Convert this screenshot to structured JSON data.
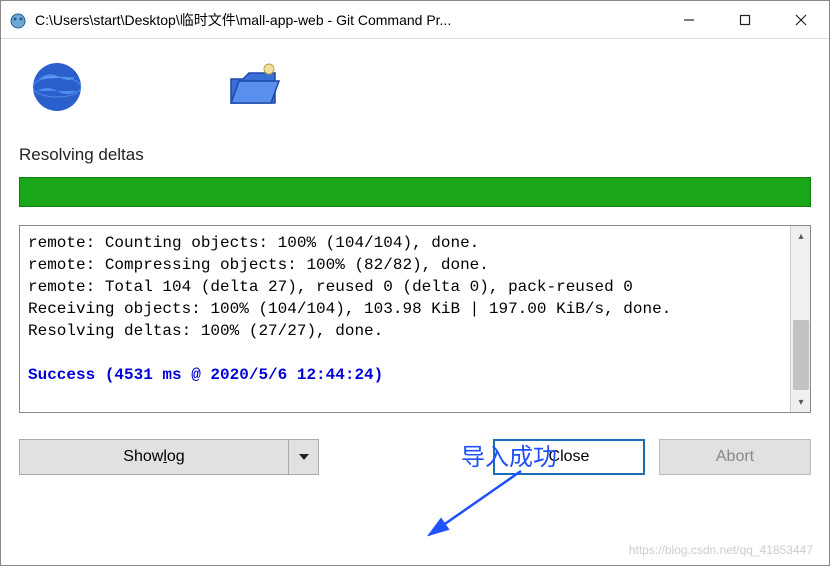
{
  "window": {
    "title": "C:\\Users\\start\\Desktop\\临时文件\\mall-app-web - Git Command Pr..."
  },
  "status": {
    "label": "Resolving deltas"
  },
  "log": {
    "lines": [
      "remote: Counting objects: 100% (104/104), done.",
      "remote: Compressing objects: 100% (82/82), done.",
      "remote: Total 104 (delta 27), reused 0 (delta 0), pack-reused 0",
      "Receiving objects: 100% (104/104), 103.98 KiB | 197.00 KiB/s, done.",
      "Resolving deltas: 100% (27/27), done."
    ],
    "success": "Success (4531 ms @ 2020/5/6 12:44:24)"
  },
  "annotation": {
    "text": "导入成功"
  },
  "buttons": {
    "showlog_pre": "Show ",
    "showlog_u": "l",
    "showlog_post": "og",
    "close": "Close",
    "abort": "Abort"
  },
  "watermark": "https://blog.csdn.net/qq_41853447"
}
